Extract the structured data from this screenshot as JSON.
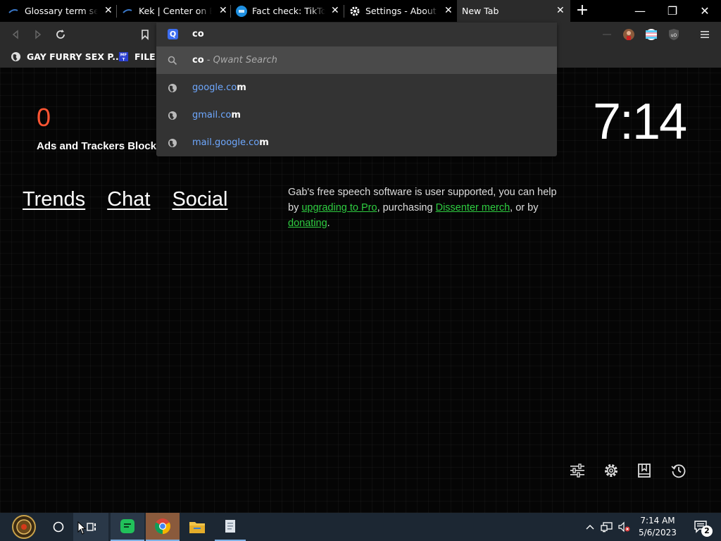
{
  "tabs": [
    {
      "title": "Glossary term search",
      "favicon": "tab-favicon-generic"
    },
    {
      "title": "Kek | Center on Extremism",
      "favicon": "tab-favicon-generic"
    },
    {
      "title": "Fact check: TikTok",
      "favicon": "tab-favicon-blue-circle"
    },
    {
      "title": "Settings - About Dissenter",
      "favicon": "gear-icon"
    },
    {
      "title": "New Tab",
      "favicon": "none",
      "active": true
    }
  ],
  "tab_close_glyph": "✕",
  "new_tab_glyph": "+",
  "window_controls": {
    "minimize": "—",
    "maximize": "❐",
    "close": "✕"
  },
  "bookmarks": [
    {
      "label": "GAY FURRY SEX P...",
      "icon": "globe-icon"
    },
    {
      "label": "FILE",
      "icon": "file-icon"
    }
  ],
  "omnibox": {
    "typed_text": "co",
    "engine_icon": "Q",
    "suggestions": [
      {
        "type": "search",
        "query": "co",
        "engine": " - Qwant Search",
        "icon": "search-icon"
      },
      {
        "type": "url",
        "match": "google.co",
        "rest": "m",
        "icon": "globe-icon"
      },
      {
        "type": "url",
        "match": "gmail.co",
        "rest": "m",
        "icon": "globe-icon"
      },
      {
        "type": "url",
        "match": "mail.google.co",
        "rest": "m",
        "icon": "globe-icon"
      }
    ]
  },
  "newtab": {
    "blocked_count": "0",
    "blocked_label": "Ads and Trackers Blocked",
    "clock": "7:14",
    "nav_links": [
      "Trends",
      "Chat",
      "Social"
    ],
    "gab_text_1": "Gab's free speech software is user supported, you can help by ",
    "gab_link_1": "upgrading to Pro",
    "gab_text_2": ", purchasing ",
    "gab_link_2": "Dissenter merch",
    "gab_text_3": ", or by ",
    "gab_link_3": "donating",
    "gab_text_4": ".",
    "tools": [
      "sliders-icon",
      "gear-icon",
      "bookmark-icon",
      "history-icon"
    ]
  },
  "taskbar": {
    "time": "7:14 AM",
    "date": "5/6/2023",
    "notification_count": "2",
    "tray_chevron": "^"
  },
  "colors": {
    "accent_blue": "#6ea8ff",
    "blocked_red": "#ff5533",
    "link_green": "#2ecc40",
    "taskbar_bg": "#1c2733"
  }
}
